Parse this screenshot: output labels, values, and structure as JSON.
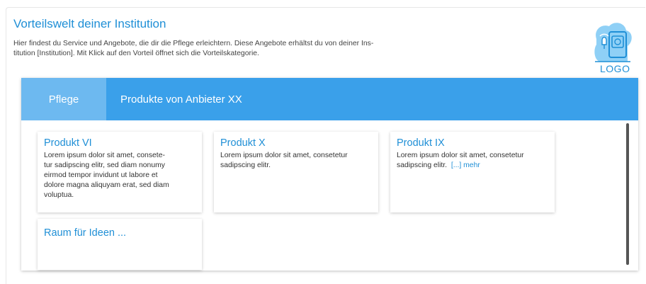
{
  "header": {
    "title": "Vorteilswelt deiner Institution",
    "intro_line1": "Hier findest du Service und Angebote, die dir die Pflege erleichtern. Diese Angebote erhältst du von deiner Ins-",
    "intro_line2": "titution [Institution]. Mit Klick auf den Vorteil öffnet sich die Vorteilskategorie.",
    "logo_label": "LOGO"
  },
  "tabs": [
    {
      "label": "Pflege",
      "active": true
    },
    {
      "label": "Produkte von Anbieter XX",
      "active": false
    }
  ],
  "cards": [
    {
      "title": "Produkt VI",
      "lines": [
        "Lorem ipsum dolor sit amet, consete-",
        "tur sadipscing elitr, sed diam nonumy",
        "eirmod tempor invidunt ut labore et",
        "dolore magna aliquyam erat, sed diam",
        "voluptua."
      ]
    },
    {
      "title": "Produkt X",
      "lines": [
        "Lorem ipsum dolor sit amet, consetetur",
        "sadipscing elitr."
      ]
    },
    {
      "title": "Produkt IX",
      "lines": [
        "Lorem ipsum dolor sit amet, consetetur",
        "sadipscing elitr."
      ],
      "more": "[...] mehr"
    },
    {
      "title": "Raum für Ideen ..."
    }
  ],
  "colors": {
    "accent": "#1f8fd6",
    "tabbar": "#3aa0ea",
    "tab_active": "#6db9f0"
  },
  "icons": {
    "logo": "security-device-icon"
  }
}
